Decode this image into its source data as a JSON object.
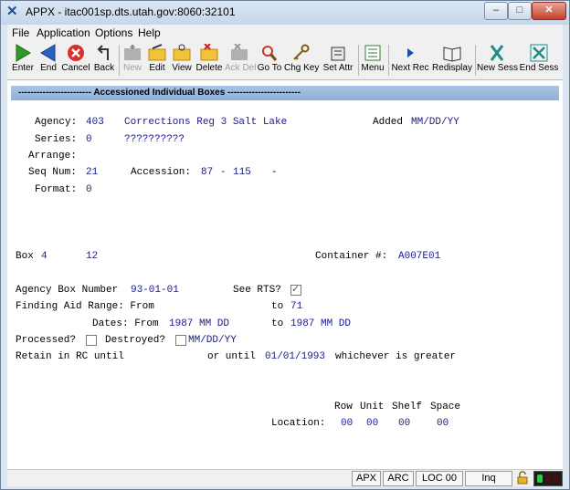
{
  "window": {
    "title": "APPX - itac001sp.dts.utah.gov:8060:32101"
  },
  "menu": [
    "File",
    "Application",
    "Options",
    "Help"
  ],
  "toolbar": {
    "enter": "Enter",
    "end": "End",
    "cancel": "Cancel",
    "back": "Back",
    "new": "New",
    "edit": "Edit",
    "view": "View",
    "delete": "Delete",
    "ackdel": "Ack Del",
    "goto": "Go To",
    "chgkey": "Chg Key",
    "setattr": "Set Attr",
    "menu": "Menu",
    "nextrec": "Next Rec",
    "redisplay": "Redisplay",
    "newsess": "New Sess",
    "endsess": "End Sess"
  },
  "banner": "------------------------ Accessioned Individual Boxes ------------------------",
  "form": {
    "agency_label": "Agency:",
    "agency_code": "403",
    "agency_name": "Corrections Reg 3 Salt Lake",
    "added_label": "Added",
    "added_value": "MM/DD/YY",
    "series_label": "Series:",
    "series_value": "0",
    "series_name": "??????????",
    "arrange_label": "Arrange:",
    "seq_label": "Seq Num:",
    "seq_value": "21",
    "accession_label": "Accession:",
    "accession_a": "87",
    "accession_dash": "-",
    "accession_b": "115",
    "accession_trail": "-",
    "format_label": "Format:",
    "format_value": "0",
    "box_label": "Box",
    "box_a": "4",
    "box_b": "12",
    "container_label": "Container #:",
    "container_value": "A007E01",
    "agency_box_label": "Agency Box Number",
    "agency_box_value": "93-01-01",
    "see_rts_label": "See RTS?",
    "finding_label": "Finding Aid Range: From",
    "finding_to": "to",
    "finding_to_value": "71",
    "dates_label": "Dates: From",
    "dates_from_value": "1987 MM DD",
    "dates_to": "to",
    "dates_to_value": "1987 MM DD",
    "processed_label": "Processed?",
    "destroyed_label": "Destroyed?",
    "destroyed_date": "MM/DD/YY",
    "retain_label": "Retain in RC until",
    "or_until_label": "or until",
    "or_until_value": "01/01/1993",
    "greater_label": "whichever is greater",
    "col_row": "Row",
    "col_unit": "Unit",
    "col_shelf": "Shelf",
    "col_space": "Space",
    "location_label": "Location:",
    "loc_row": "00",
    "loc_unit": "00",
    "loc_shelf": "00",
    "loc_space": "00"
  },
  "status": {
    "apx": "APX",
    "arc": "ARC",
    "loc": "LOC 00",
    "inq": "Inq"
  }
}
